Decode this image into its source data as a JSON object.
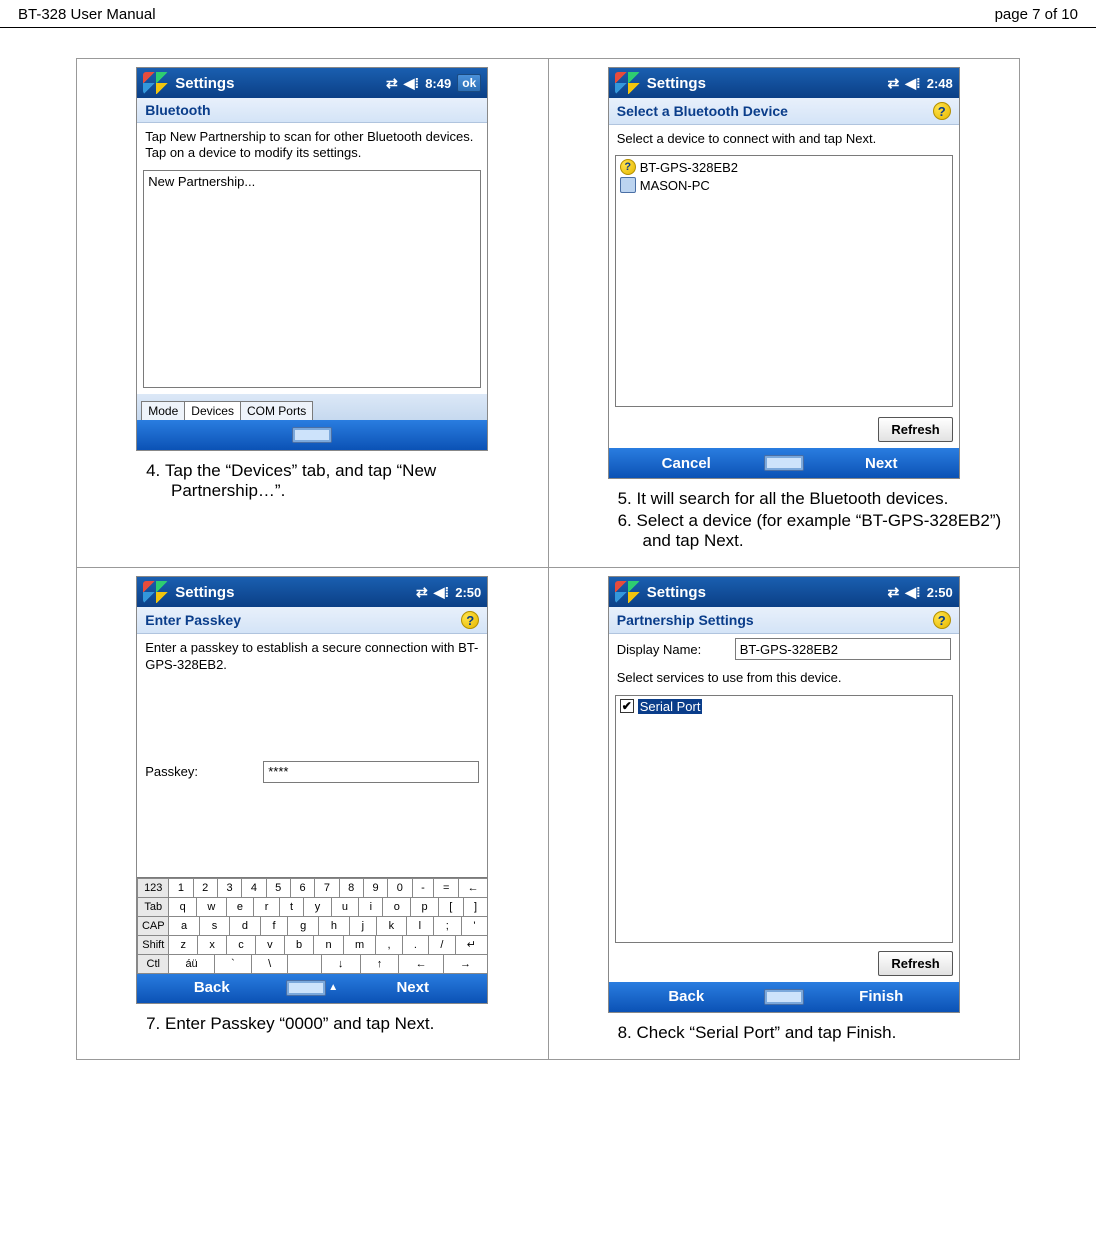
{
  "header": {
    "doc_title": "BT-328 User Manual",
    "page_info": "page 7 of 10"
  },
  "cells": {
    "a": {
      "titlebar_title": "Settings",
      "time": "8:49",
      "ok": "ok",
      "subheader": "Bluetooth",
      "instruction": "Tap New Partnership to scan for other Bluetooth devices. Tap on a device to modify its settings.",
      "list_item": "New Partnership...",
      "tabs": {
        "mode": "Mode",
        "devices": "Devices",
        "com": "COM Ports"
      },
      "caption_4": "Tap the “Devices” tab, and tap “New Partnership…”."
    },
    "b": {
      "titlebar_title": "Settings",
      "time": "2:48",
      "subheader": "Select a Bluetooth Device",
      "instruction": "Select a device to connect with and tap Next.",
      "device1": "BT-GPS-328EB2",
      "device2": "MASON-PC",
      "refresh": "Refresh",
      "soft_left": "Cancel",
      "soft_right": "Next",
      "caption_5": "It will search for all the Bluetooth devices.",
      "caption_6": "Select a device (for example “BT-GPS-328EB2”) and tap Next."
    },
    "c": {
      "titlebar_title": "Settings",
      "time": "2:50",
      "subheader": "Enter Passkey",
      "instruction": "Enter a passkey to establish a secure connection with BT-GPS-328EB2.",
      "passkey_label": "Passkey:",
      "passkey_value": "****",
      "soft_left": "Back",
      "soft_right": "Next",
      "caption_7": "Enter Passkey “0000” and tap Next."
    },
    "d": {
      "titlebar_title": "Settings",
      "time": "2:50",
      "subheader": "Partnership Settings",
      "display_name_label": "Display Name:",
      "display_name_value": "BT-GPS-328EB2",
      "services_instr": "Select services to use from this device.",
      "service1": "Serial Port",
      "refresh": "Refresh",
      "soft_left": "Back",
      "soft_right": "Finish",
      "caption_8": "Check “Serial Port” and tap Finish."
    }
  },
  "osk": {
    "row1": [
      "123",
      "1",
      "2",
      "3",
      "4",
      "5",
      "6",
      "7",
      "8",
      "9",
      "0",
      "-",
      "=",
      "←"
    ],
    "row2": [
      "Tab",
      "q",
      "w",
      "e",
      "r",
      "t",
      "y",
      "u",
      "i",
      "o",
      "p",
      "[",
      "]"
    ],
    "row3": [
      "CAP",
      "a",
      "s",
      "d",
      "f",
      "g",
      "h",
      "j",
      "k",
      "l",
      ";",
      "'"
    ],
    "row4": [
      "Shift",
      "z",
      "x",
      "c",
      "v",
      "b",
      "n",
      "m",
      ",",
      ".",
      "/",
      "↵"
    ],
    "row5": [
      "Ctl",
      "áü",
      "`",
      "\\",
      " ",
      "↓",
      "↑",
      "←",
      "→"
    ]
  }
}
